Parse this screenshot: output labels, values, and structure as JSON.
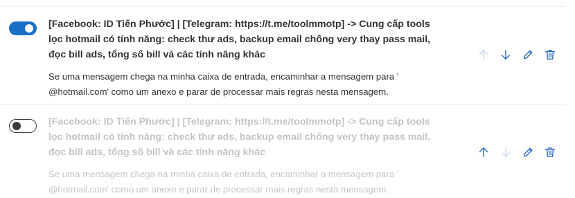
{
  "rules": [
    {
      "enabled": true,
      "title": "[Facebook: ID Tiến Phước] | [Telegram: https://t.me/toolmmotp] -> Cung cấp tools lọc hotmail có tính năng: check thư ads, backup email chống very thay pass mail, đọc bill ads, tổng số bill và các tính năng khác",
      "description": "Se uma mensagem chega na minha caixa de entrada, encaminhar a mensagem para ' @hotmail.com' como um anexo e parar de processar mais regras nesta mensagem.",
      "actions": {
        "move_up": "arrow-up-icon",
        "move_down": "arrow-down-icon",
        "edit": "pencil-icon",
        "delete": "trash-icon"
      }
    },
    {
      "enabled": false,
      "title": "[Facebook: ID Tiến Phước] | [Telegram: https://t.me/toolmmotp] -> Cung cấp tools lọc hotmail có tính năng: check thư ads, backup email chống very thay pass mail, đọc bill ads, tổng số bill và các tính năng khác",
      "description": "Se uma mensagem chega na minha caixa de entrada, encaminhar a mensagem para ' @hotmail.com' como um anexo e parar de processar mais regras nesta mensagem.",
      "actions": {
        "move_up": "arrow-up-icon",
        "move_down": "arrow-down-icon",
        "edit": "pencil-icon",
        "delete": "trash-icon"
      }
    }
  ],
  "colors": {
    "accent": "#1a6fc7",
    "icon_active": "#2f6cc0",
    "icon_disabled": "#c9d7ea",
    "text": "#333333",
    "text_disabled": "#c4c4c4"
  }
}
